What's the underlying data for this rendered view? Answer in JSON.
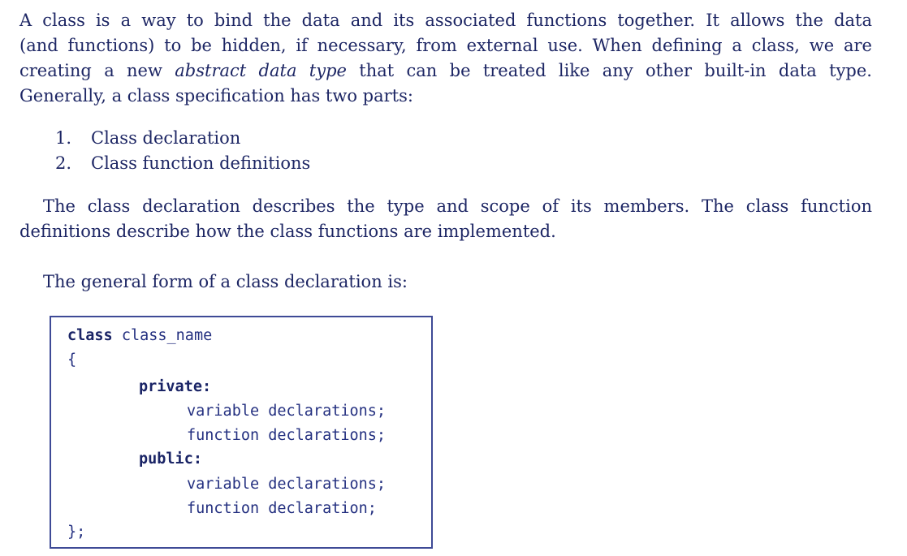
{
  "intro": {
    "line1": "A class is a way to bind the data and its associated functions together. It allows the data",
    "line2": "(and functions) to be hidden, if necessary, from external use. When defining a class, we are",
    "line3_a": "creating a new ",
    "line3_em": "abstract data type",
    "line3_b": " that can be treated like any other built-in data type.",
    "line4": "Generally, a class specification has two parts:"
  },
  "parts": [
    {
      "num": "1.",
      "label": "Class declaration"
    },
    {
      "num": "2.",
      "label": "Class function definitions"
    }
  ],
  "declaration_para": {
    "line1": "The class declaration describes the type and scope of its members. The class function",
    "line2": "definitions describe how the class functions are implemented."
  },
  "general_form": "The general form of a class declaration is:",
  "code": {
    "line1_kw": "class",
    "line1_rest": " class_name",
    "open_brace": "{",
    "private_kw": "private:",
    "private_var": "variable declarations;",
    "private_func": "function declarations;",
    "public_kw": "public:",
    "public_var": "variable declarations;",
    "public_func": "function declaration;",
    "close": "};"
  }
}
